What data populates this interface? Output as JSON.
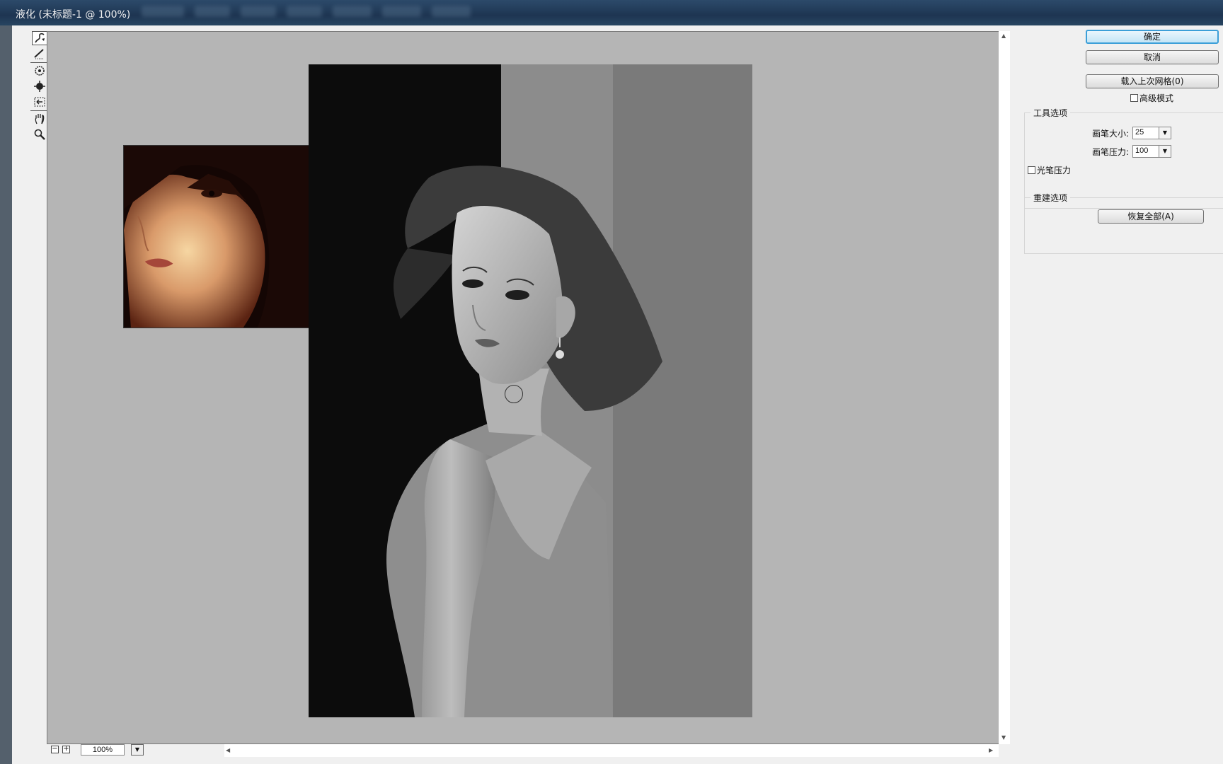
{
  "window": {
    "title": "液化 (未标题-1 @ 100%)"
  },
  "toolbox": {
    "tools": [
      "forward-warp-tool",
      "reconstruct-tool",
      "pucker-tool",
      "bloat-tool",
      "push-left-tool",
      "hand-tool",
      "zoom-tool"
    ]
  },
  "zoom": {
    "value": "100%",
    "minus": "−",
    "plus": "+"
  },
  "panel": {
    "ok_label": "确定",
    "cancel_label": "取消",
    "load_mesh_label": "载入上次网格(0)",
    "advanced_mode_label": "高级模式",
    "tool_options": {
      "title": "工具选项",
      "brush_size_label": "画笔大小:",
      "brush_size_value": "25",
      "brush_pressure_label": "画笔压力:",
      "brush_pressure_value": "100",
      "stylus_pressure_label": "光笔压力"
    },
    "reconstruct_options": {
      "title": "重建选项",
      "restore_all_label": "恢复全部(A)"
    }
  }
}
